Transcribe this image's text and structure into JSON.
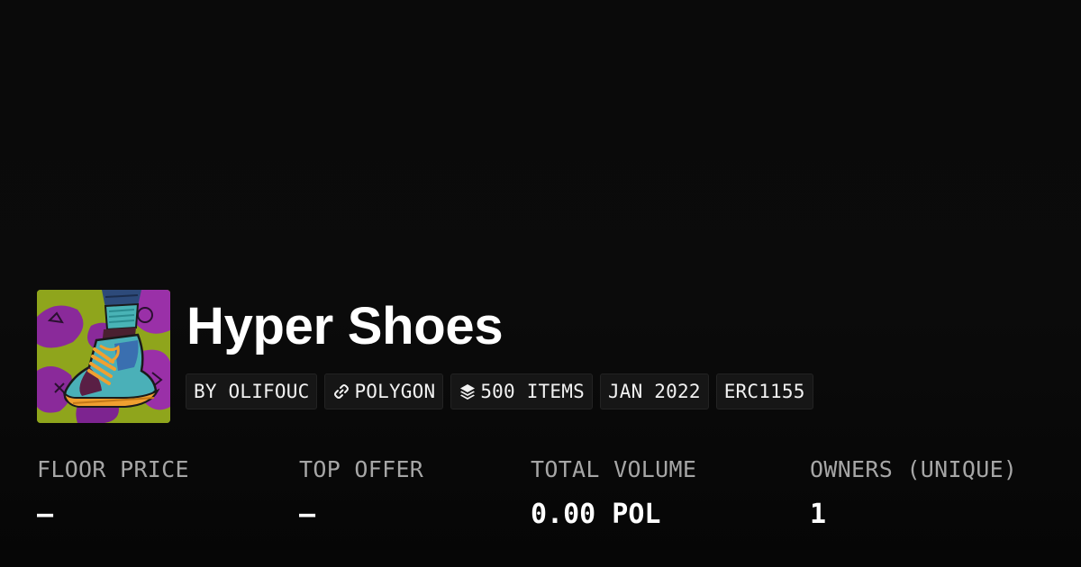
{
  "collection": {
    "name": "Hyper Shoes",
    "image_alt": "Hyper Shoes collection image"
  },
  "tags": [
    {
      "label": "BY OLIFOUC",
      "icon": null
    },
    {
      "label": "POLYGON",
      "icon": "chain-link-icon"
    },
    {
      "label": "500 ITEMS",
      "icon": "layers-icon"
    },
    {
      "label": "JAN 2022",
      "icon": null
    },
    {
      "label": "ERC1155",
      "icon": null
    }
  ],
  "stats": {
    "floor_price": {
      "label": "FLOOR PRICE",
      "value": "–"
    },
    "top_offer": {
      "label": "TOP OFFER",
      "value": "–"
    },
    "total_volume": {
      "label": "TOTAL VOLUME",
      "value": "0.00 POL"
    },
    "owners": {
      "label": "OWNERS (UNIQUE)",
      "value": "1"
    }
  },
  "colors": {
    "background": "#0b0b0b",
    "text": "#ffffff",
    "label": "#a6a6a6",
    "tag_background": "#161616"
  }
}
